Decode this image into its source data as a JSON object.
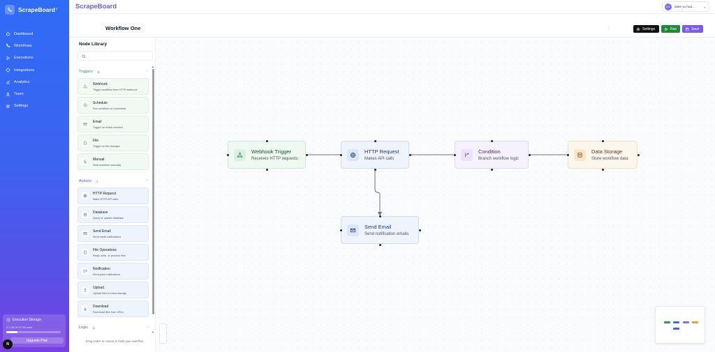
{
  "brand": {
    "name": "ScrapeBoard",
    "collapse_icon": "chevron-left-icon"
  },
  "nav": {
    "items": [
      {
        "label": "Dashboard",
        "icon": "home-icon"
      },
      {
        "label": "Workflows",
        "icon": "workflow-icon"
      },
      {
        "label": "Executions",
        "icon": "play-icon"
      },
      {
        "label": "Integrations",
        "icon": "puzzle-icon"
      },
      {
        "label": "Analytics",
        "icon": "chart-icon"
      },
      {
        "label": "Team",
        "icon": "users-icon"
      },
      {
        "label": "Settings",
        "icon": "gear-icon"
      }
    ]
  },
  "storage": {
    "title": "Execution Storage",
    "used_text": "2.1 GB of 10 GB used",
    "used_fraction": 0.21,
    "upgrade_label": "Upgrade Plan"
  },
  "badge": {
    "text": "N"
  },
  "topbar": {
    "title": "ScrapeBoard",
    "user_initials": "DV",
    "user_name": "duke vu hoa..."
  },
  "workflow": {
    "name": "Workflow One",
    "settings_label": "Settings",
    "run_label": "Run",
    "save_label": "Save"
  },
  "library": {
    "title": "Node Library",
    "search_placeholder": "",
    "footer": "Drag nodes to canvas to build your workflow",
    "sections": {
      "triggers": {
        "label": "Triggers",
        "count": "5",
        "color": "#2e9b4c"
      },
      "actions": {
        "label": "Actions",
        "count": "7",
        "color": "#3b6fd8"
      },
      "logic": {
        "label": "Logic",
        "count": "4",
        "color": "#7b4fd6"
      }
    },
    "triggers": [
      {
        "title": "Webhook",
        "desc": "Trigger workflow from HTTP webhook",
        "icon": "webhook-icon"
      },
      {
        "title": "Schedule",
        "desc": "Run workflow on a schedule",
        "icon": "clock-icon"
      },
      {
        "title": "Email",
        "desc": "Trigger on email received",
        "icon": "mail-icon"
      },
      {
        "title": "File",
        "desc": "Trigger on file changes",
        "icon": "file-icon"
      },
      {
        "title": "Manual",
        "desc": "Start workflow manually",
        "icon": "pointer-icon"
      }
    ],
    "actions": [
      {
        "title": "HTTP Request",
        "desc": "Make HTTP API calls",
        "icon": "globe-icon"
      },
      {
        "title": "Database",
        "desc": "Query or update database",
        "icon": "database-icon"
      },
      {
        "title": "Send Email",
        "desc": "Send email notifications",
        "icon": "mail-icon"
      },
      {
        "title": "File Operations",
        "desc": "Read, write, or process files",
        "icon": "file-icon"
      },
      {
        "title": "Notification",
        "desc": "Send push notifications",
        "icon": "message-icon"
      },
      {
        "title": "Upload",
        "desc": "Upload files to cloud storage",
        "icon": "upload-icon"
      },
      {
        "title": "Download",
        "desc": "Download files from URLs",
        "icon": "download-icon"
      }
    ]
  },
  "canvas": {
    "nodes": {
      "webhook": {
        "title": "Webhook Trigger",
        "desc": "Receives HTTP requests",
        "icon": "webhook-icon"
      },
      "http": {
        "title": "HTTP Request",
        "desc": "Makes API calls",
        "icon": "globe-icon"
      },
      "condition": {
        "title": "Condition",
        "desc": "Branch workflow logic",
        "icon": "branch-icon"
      },
      "storage": {
        "title": "Data Storage",
        "desc": "Store workflow data",
        "icon": "database-icon"
      },
      "email": {
        "title": "Send Email",
        "desc": "Send notification emails",
        "icon": "mail-icon"
      }
    }
  }
}
